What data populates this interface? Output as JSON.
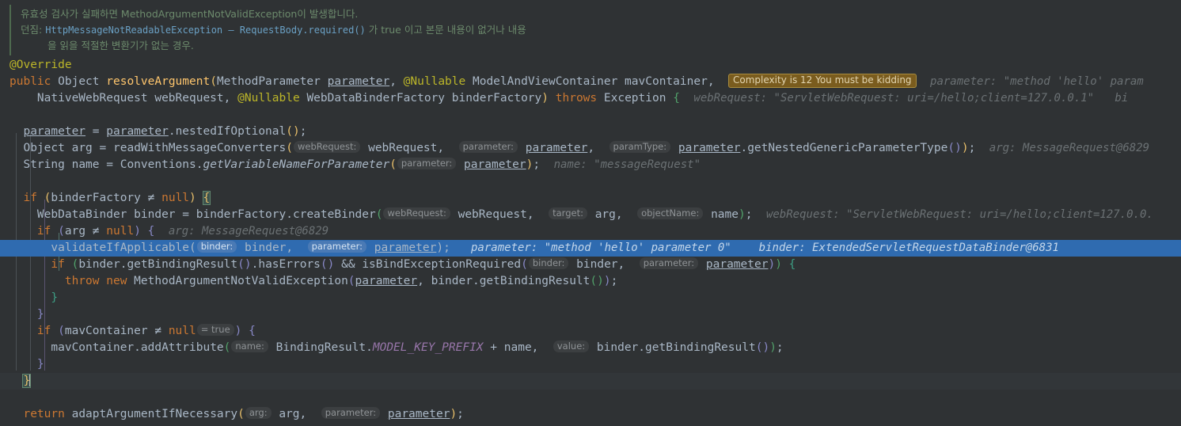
{
  "editor": {
    "theme": "darcula",
    "background": "#2f3234",
    "exec_line_color": "#2f6bb0",
    "caret_line_color": "#323639"
  },
  "note": {
    "line1": "유효성 검사가 실패하면 MethodArgumentNotValidException이 발생합니다.",
    "line2_label": "던짐: ",
    "line2_code": "HttpMessageNotReadableException – RequestBody.required()",
    "line2_tail": " 가 true 이고 본문 내용이 없거나 내용",
    "line3": "을 읽을 적절한 변환기가 없는 경우."
  },
  "badge": {
    "complexity": "Complexity is 12 You must be kidding",
    "bg": "#7a5c1e",
    "border": "#a98c3e"
  },
  "code": {
    "annotation_override": "@Override",
    "kw_public": "public",
    "type_object": "Object",
    "method_name": "resolveArgument",
    "type_methodparameter": "MethodParameter",
    "param_parameter": "parameter",
    "annotation_nullable": "@Nullable",
    "type_mavcontainer": "ModelAndViewContainer",
    "param_mavcontainer": "mavContainer",
    "type_nativewebrequest": "NativeWebRequest",
    "param_webrequest": "webRequest",
    "type_binderfactory": "WebDataBinderFactory",
    "param_binderfactory": "binderFactory",
    "kw_throws": "throws",
    "type_exception": "Exception",
    "stmt_nested": "nestedIfOptional",
    "type_string": "String",
    "var_name": "name",
    "cls_conventions": "Conventions",
    "meth_getvarname": "getVariableNameForParameter",
    "var_arg": "arg",
    "meth_readwith": "readWithMessageConverters",
    "meth_getnested": "getNestedGenericParameterType",
    "kw_if": "if",
    "kw_null": "null",
    "neq": "≠",
    "type_webdatabinder": "WebDataBinder",
    "var_binder": "binder",
    "meth_createbinder": "createBinder",
    "meth_validate": "validateIfApplicable",
    "meth_getbindingresult": "getBindingResult",
    "meth_haserrors": "hasErrors",
    "meth_isbindexc": "isBindExceptionRequired",
    "kw_throw": "throw",
    "kw_new": "new",
    "exc_manve": "MethodArgumentNotValidException",
    "meth_addattribute": "addAttribute",
    "cls_bindingresult": "BindingResult",
    "const_model_key_prefix": "MODEL_KEY_PREFIX",
    "kw_return": "return",
    "meth_adapt": "adaptArgumentIfNecessary"
  },
  "hints": {
    "webRequest": "webRequest:",
    "parameter": "parameter:",
    "paramType": "paramType:",
    "target": "target:",
    "objectName": "objectName:",
    "binder": "binder:",
    "name": "name:",
    "value": "value:",
    "arg": "arg:",
    "eq_true": "= true"
  },
  "debug_values": {
    "sig_parameter": "parameter: \"method 'hello' param",
    "sig_webrequest": "webRequest: \"ServletWebRequest: uri=/hello;client=127.0.0.1\"",
    "sig_bi": "bi",
    "arg_messagerequest": "arg: MessageRequest@6829",
    "name_messagerequest": "name: \"messageRequest\"",
    "createbinder_webrequest": "webRequest: \"ServletWebRequest: uri=/hello;client=127.0.0.",
    "if_arg": "arg: MessageRequest@6829",
    "validate_parameter": "parameter: \"method 'hello' parameter 0\"",
    "validate_binder": "binder: ExtendedServletRequestDataBinder@6831"
  }
}
